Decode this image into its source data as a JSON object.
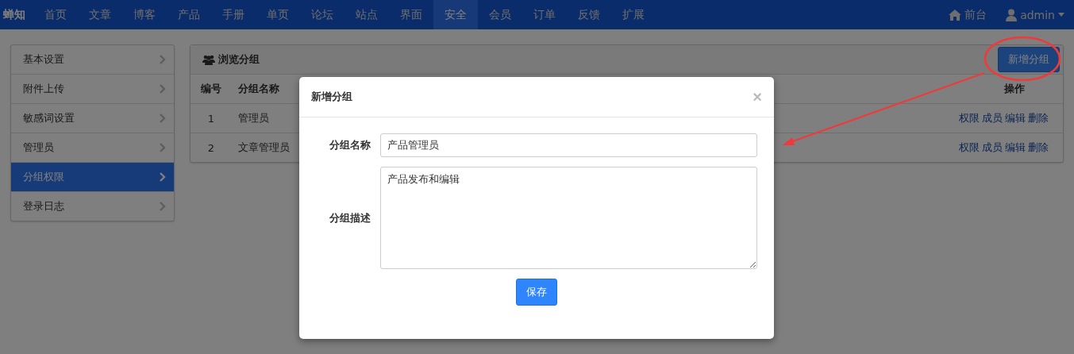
{
  "navbar": {
    "brand": "蝉知",
    "items": [
      {
        "label": "首页",
        "selected": false
      },
      {
        "label": "文章",
        "selected": false
      },
      {
        "label": "博客",
        "selected": false
      },
      {
        "label": "产品",
        "selected": false
      },
      {
        "label": "手册",
        "selected": false
      },
      {
        "label": "单页",
        "selected": false
      },
      {
        "label": "论坛",
        "selected": false
      },
      {
        "label": "站点",
        "selected": false
      },
      {
        "label": "界面",
        "selected": false
      },
      {
        "label": "安全",
        "selected": true
      },
      {
        "label": "会员",
        "selected": false
      },
      {
        "label": "订单",
        "selected": false
      },
      {
        "label": "反馈",
        "selected": false
      },
      {
        "label": "扩展",
        "selected": false
      }
    ],
    "frontend_link": "前台",
    "user_menu": "admin"
  },
  "sidebar": {
    "items": [
      {
        "label": "基本设置",
        "selected": false
      },
      {
        "label": "附件上传",
        "selected": false
      },
      {
        "label": "敏感词设置",
        "selected": false
      },
      {
        "label": "管理员",
        "selected": false
      },
      {
        "label": "分组权限",
        "selected": true
      },
      {
        "label": "登录日志",
        "selected": false
      }
    ]
  },
  "panel": {
    "title": "浏览分组",
    "add_button": "新增分组",
    "table": {
      "columns": [
        "编号",
        "分组名称",
        "操作"
      ],
      "rows": [
        {
          "cells": [
            "1",
            "管理员"
          ],
          "actions": [
            "权限",
            "成员",
            "编辑",
            "删除"
          ]
        },
        {
          "cells": [
            "2",
            "文章管理员"
          ],
          "actions": [
            "权限",
            "成员",
            "编辑",
            "删除"
          ]
        }
      ]
    }
  },
  "dialog": {
    "title": "新增分组",
    "close": "×",
    "fields": [
      {
        "kind": "input",
        "label": "分组名称",
        "value": "产品管理员"
      },
      {
        "kind": "textarea",
        "label": "分组描述",
        "value": "产品发布和编辑"
      }
    ],
    "submit": "保存"
  }
}
